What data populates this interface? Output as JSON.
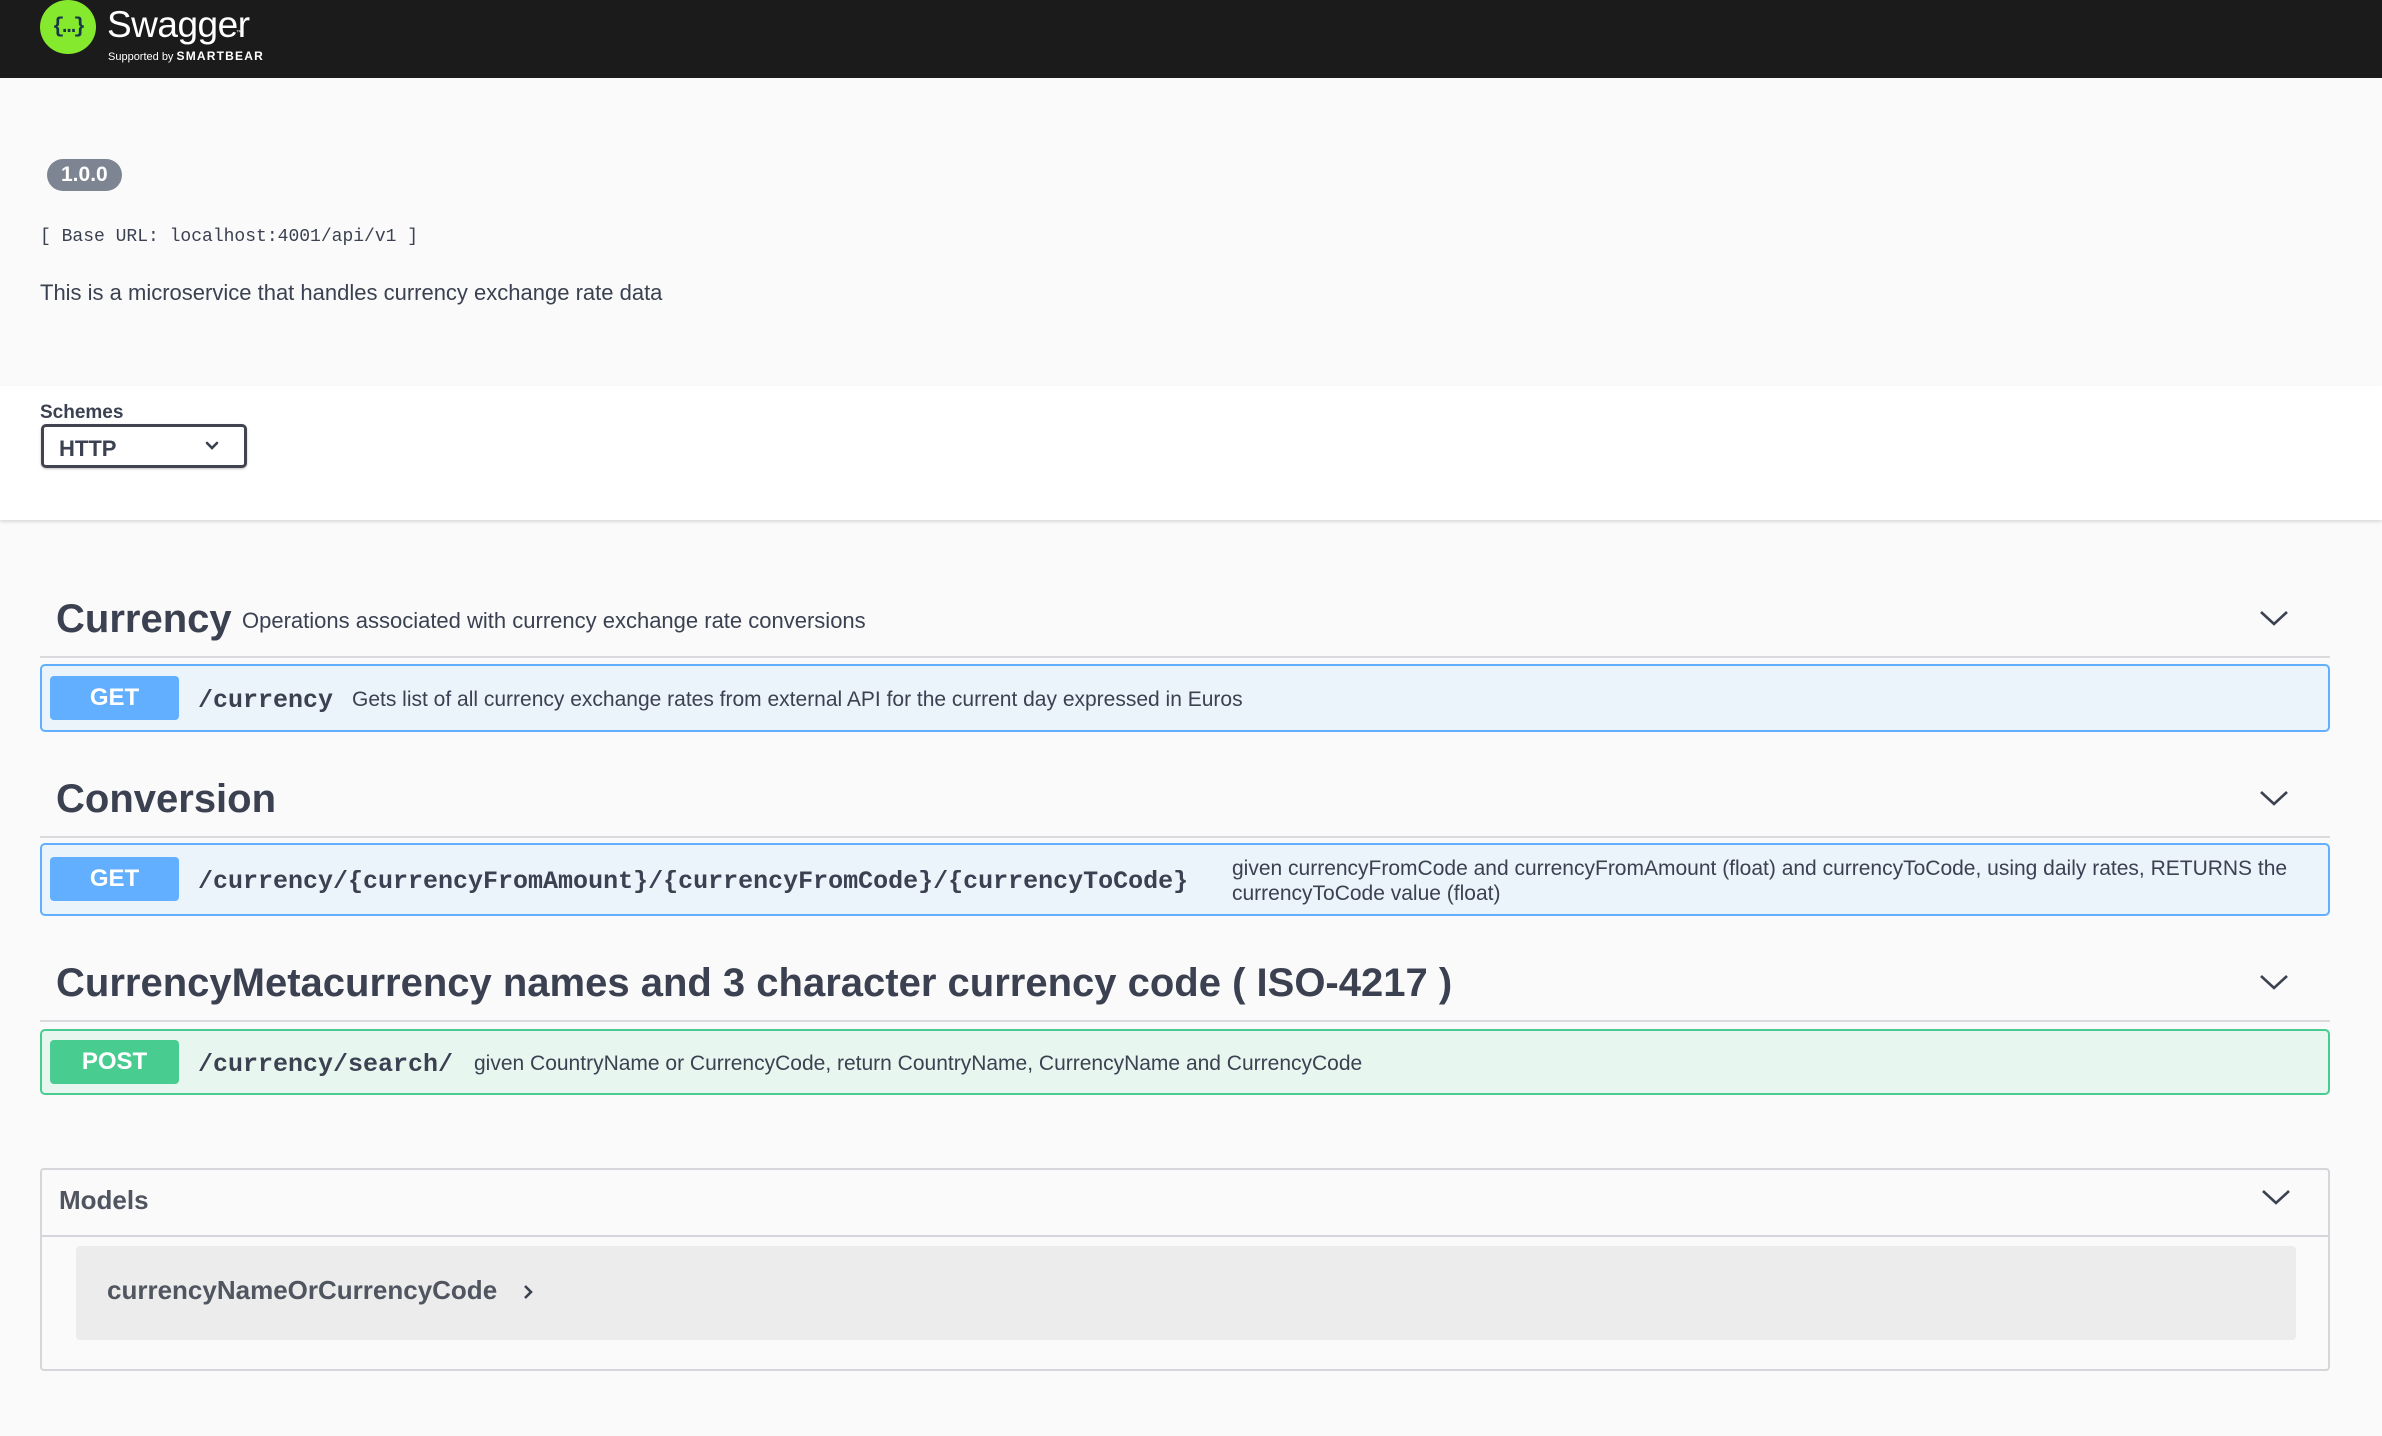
{
  "topbar": {
    "logo_glyph": "{…}",
    "title": "Swagger",
    "supported_by": "Supported by",
    "company": "SMARTBEAR",
    "background": "#1b1b1b",
    "logo_color": "#85ea2d"
  },
  "info": {
    "version": "1.0.0",
    "base_url": "[ Base URL: localhost:4001/api/v1 ]",
    "description": "This is a microservice that handles currency exchange rate data"
  },
  "schemes": {
    "label": "Schemes",
    "selected": "HTTP",
    "icon": "chevron-down-icon"
  },
  "tags": [
    {
      "name": "Currency",
      "description": "Operations associated with currency exchange rate conversions",
      "icon": "chevron-down-icon",
      "operations": [
        {
          "method": "GET",
          "path": "/currency",
          "summary": "Gets list of all currency exchange rates from external API for the current day expressed in Euros"
        }
      ]
    },
    {
      "name": "Conversion",
      "description": "",
      "icon": "chevron-down-icon",
      "operations": [
        {
          "method": "GET",
          "path": "/currency/{currencyFromAmount}/{currencyFromCode}/{currencyToCode}",
          "summary": "given currencyFromCode and currencyFromAmount (float) and currencyToCode, using daily rates, RETURNS the currencyToCode value (float)"
        }
      ]
    },
    {
      "name": "CurrencyMetacurrency names and 3 character currency code ( ISO-4217 )",
      "description": "",
      "icon": "chevron-down-icon",
      "operations": [
        {
          "method": "POST",
          "path": "/currency/search/",
          "summary": "given CountryName or CurrencyCode, return CountryName, CurrencyName and CurrencyCode"
        }
      ]
    }
  ],
  "models": {
    "title": "Models",
    "icon": "chevron-down-icon",
    "items": [
      {
        "name": "currencyNameOrCurrencyCode",
        "icon": "chevron-right-icon"
      }
    ]
  },
  "colors": {
    "get": "#61affe",
    "get_bg": "#ebf3fb",
    "post": "#49cc90",
    "post_bg": "#e8f6f0",
    "text": "#3b4151"
  }
}
